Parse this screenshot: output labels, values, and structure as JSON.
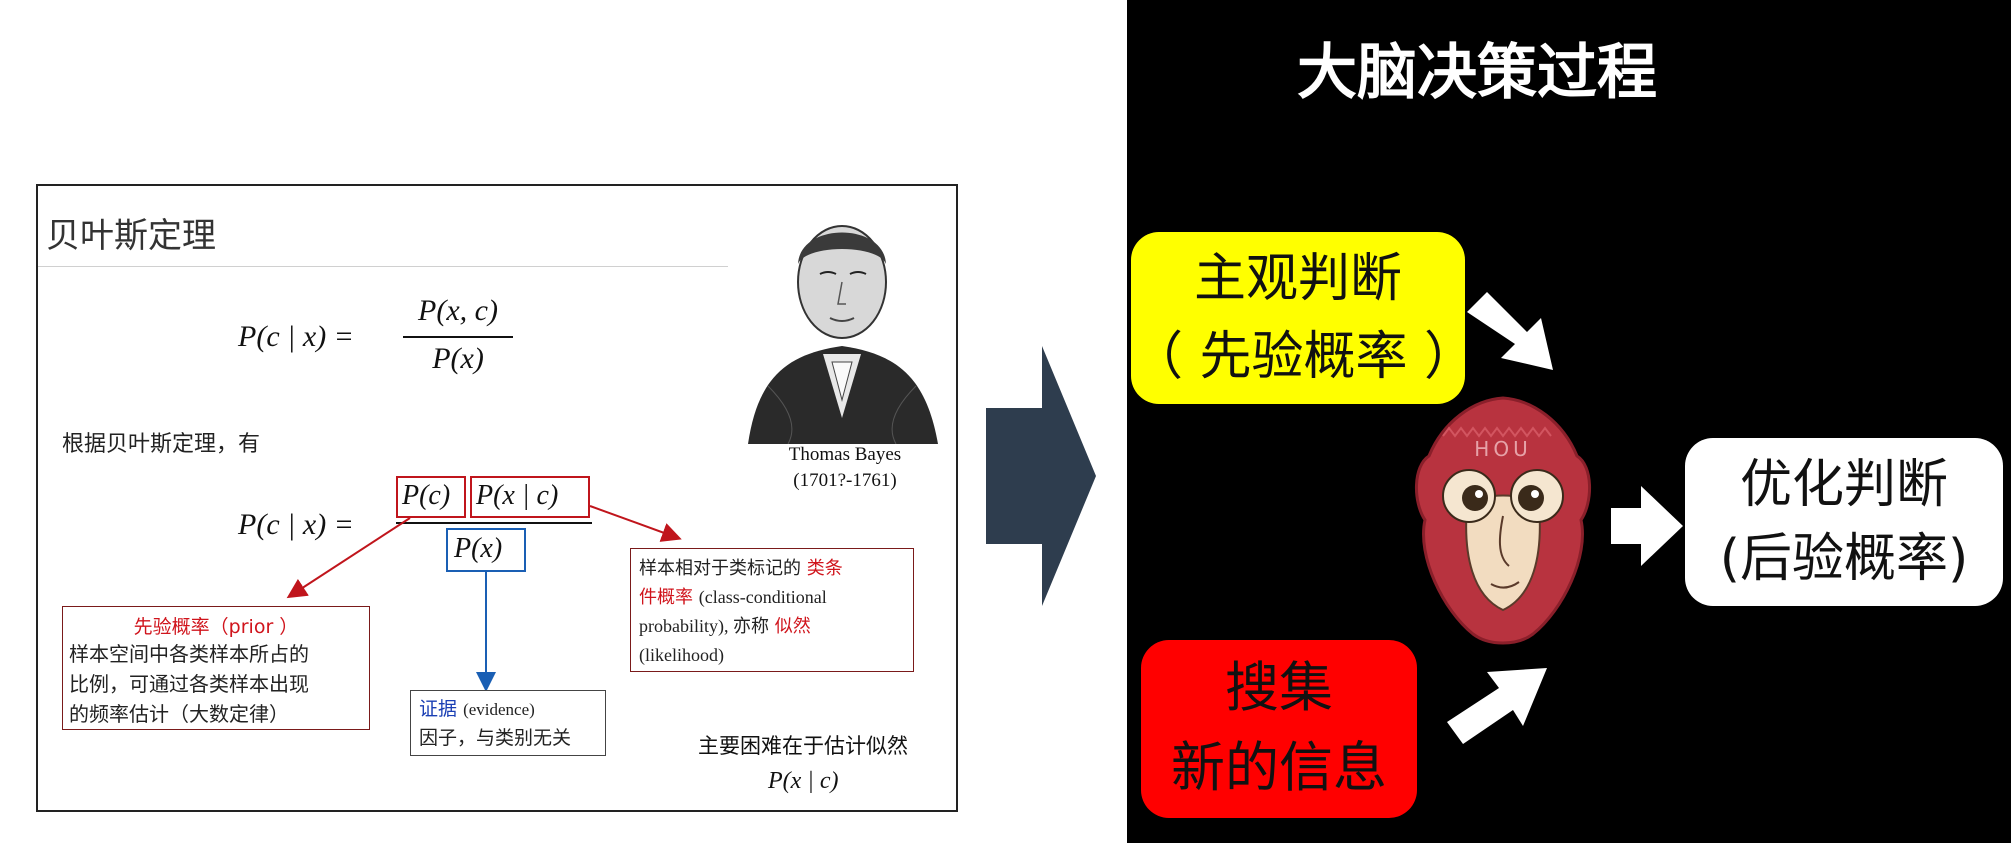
{
  "slide": {
    "title": "贝叶斯定理",
    "intro": "根据贝叶斯定理，有",
    "formula1": {
      "lhs": "P(c | x) =",
      "numerator": "P(x, c)",
      "denominator": "P(x)"
    },
    "formula2": {
      "lhs": "P(c | x) =",
      "prior": "P(c)",
      "likelihood": "P(x | c)",
      "evidence": "P(x)"
    },
    "portrait": {
      "name": "Thomas Bayes",
      "years": "(1701?-1761)"
    },
    "prior_note": {
      "heading": "先验概率（prior ）",
      "lines": [
        "样本空间中各类样本所占的",
        "比例，可通过各类样本出现",
        "的频率估计（大数定律）"
      ]
    },
    "likelihood_note": {
      "line1_plain": "样本相对于类标记的",
      "line1_red": "类条",
      "line2_red": "件概率",
      "line2_plain": "(class-conditional",
      "line3": "probability), 亦称",
      "line3_red": "似然",
      "line4": "(likelihood)"
    },
    "evidence_note": {
      "heading": "证据",
      "heading_en": "(evidence)",
      "line": "因子，与类别无关"
    },
    "difficulty": "主要困难在于估计似然",
    "difficulty_formula": "P(x | c)"
  },
  "panel": {
    "title": "大脑决策过程",
    "prior_box": {
      "line1": "主观判断",
      "line2": "（ 先验概率 ）"
    },
    "info_box": {
      "line1": "搜集",
      "line2": "新的信息"
    },
    "posterior_box": {
      "line1": "优化判断",
      "line2": "(后验概率)"
    },
    "brain_label": "HOU"
  },
  "colors": {
    "red": "#c0151c",
    "blue": "#1a5fb4",
    "yellow": "#ffff00",
    "info_red": "#ff0000",
    "arrow": "#2e3d4e"
  }
}
